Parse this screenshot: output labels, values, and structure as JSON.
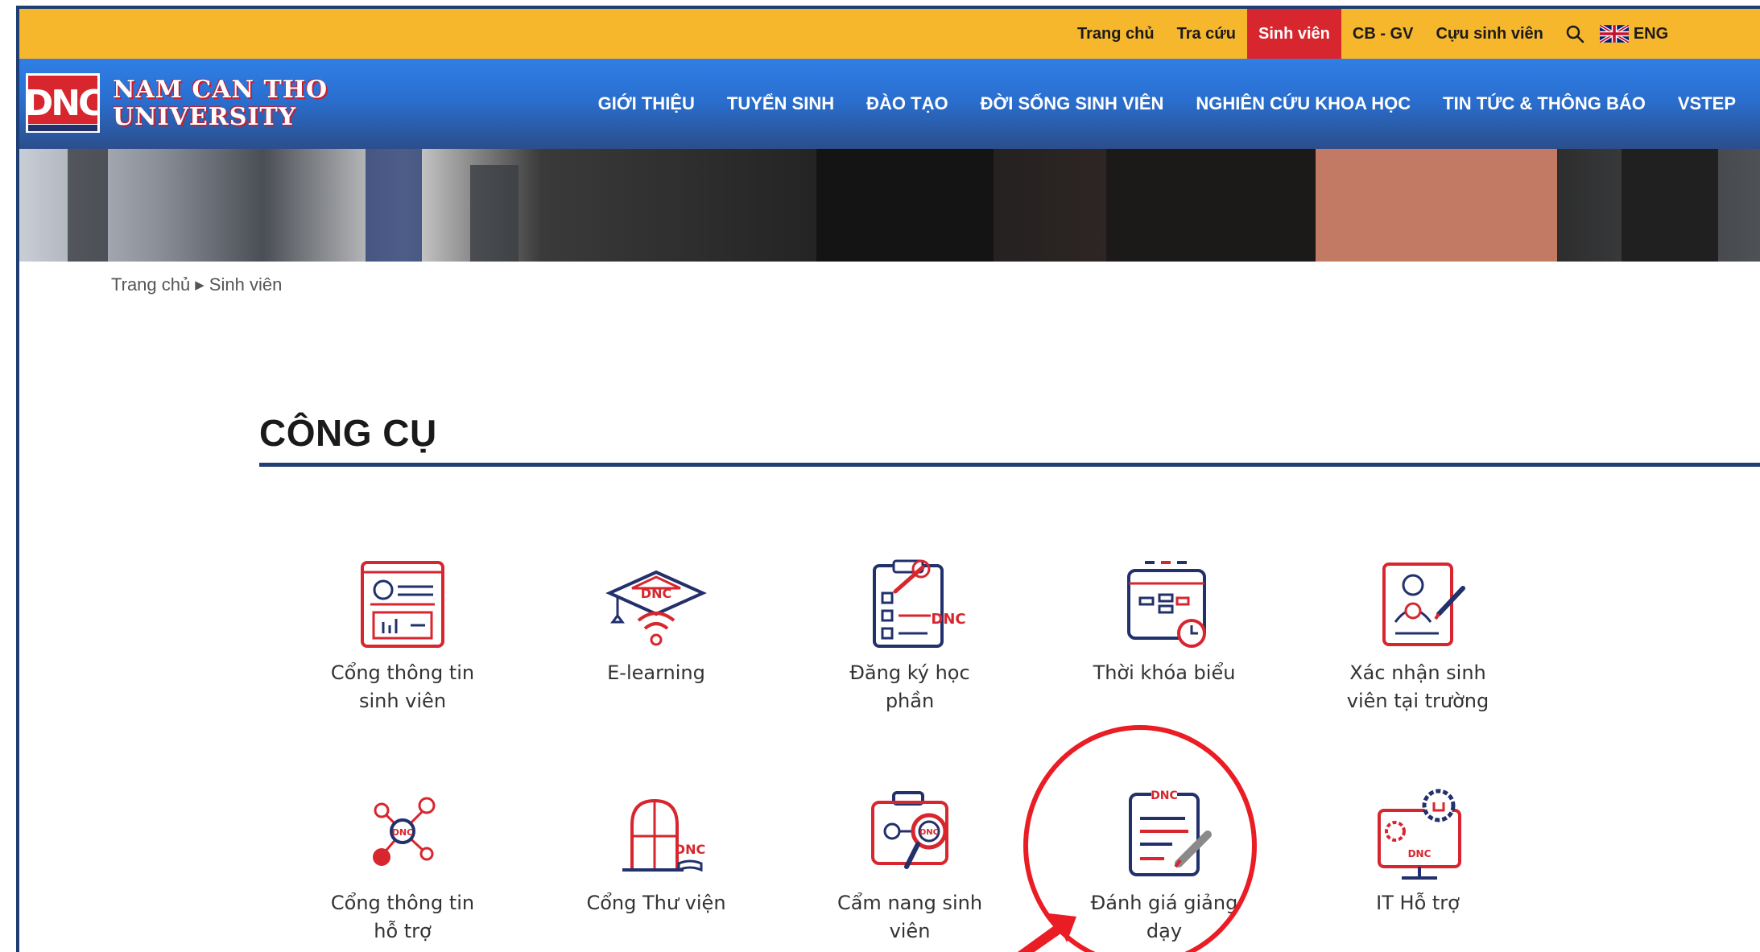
{
  "topbar": {
    "links": [
      {
        "label": "Trang chủ",
        "active": false
      },
      {
        "label": "Tra cứu",
        "active": false
      },
      {
        "label": "Sinh viên",
        "active": true
      },
      {
        "label": "CB - GV",
        "active": false
      },
      {
        "label": "Cựu sinh viên",
        "active": false
      }
    ],
    "language_label": "ENG",
    "search_icon": "search-icon",
    "flag_icon": "uk-flag-icon"
  },
  "header": {
    "logo_text_line1": "NAM CAN THO",
    "logo_text_line2": "UNIVERSITY",
    "menu": [
      {
        "label": "GIỚI THIỆU"
      },
      {
        "label": "TUYỂN SINH"
      },
      {
        "label": "ĐÀO TẠO"
      },
      {
        "label": "ĐỜI SỐNG SINH VIÊN"
      },
      {
        "label": "NGHIÊN CỨU KHOA HỌC"
      },
      {
        "label": "TIN TỨC & THÔNG BÁO"
      },
      {
        "label": "VSTEP"
      }
    ]
  },
  "breadcrumb": {
    "home": "Trang chủ",
    "current": "Sinh viên"
  },
  "section": {
    "title": "CÔNG CỤ"
  },
  "tools": [
    {
      "label_line1": "Cổng thông tin",
      "label_line2": "sinh viên",
      "icon": "student-portal-icon"
    },
    {
      "label_line1": "E-learning",
      "label_line2": "",
      "icon": "elearning-icon"
    },
    {
      "label_line1": "Đăng ký học",
      "label_line2": "phần",
      "icon": "course-registration-icon"
    },
    {
      "label_line1": "Thời khóa biểu",
      "label_line2": "",
      "icon": "timetable-icon"
    },
    {
      "label_line1": "Xác nhận sinh",
      "label_line2": "viên tại trường",
      "icon": "student-confirmation-icon"
    },
    {
      "label_line1": "Cổng thông tin",
      "label_line2": "hỗ trợ",
      "icon": "support-portal-icon"
    },
    {
      "label_line1": "Cổng Thư viện",
      "label_line2": "",
      "icon": "library-icon"
    },
    {
      "label_line1": "Cẩm nang sinh",
      "label_line2": "viên",
      "icon": "student-handbook-icon"
    },
    {
      "label_line1": "Đánh giá giảng",
      "label_line2": "dạy",
      "icon": "teaching-evaluation-icon"
    },
    {
      "label_line1": "IT Hỗ trợ",
      "label_line2": "",
      "icon": "it-support-icon"
    }
  ],
  "colors": {
    "topbar": "#f6b72d",
    "active_tab": "#d7262e",
    "nav_blue": "#2a6fd0",
    "navy": "#1f3f74",
    "icon_red": "#d7262e",
    "icon_navy": "#22306b",
    "highlight_red": "#ea1c24"
  }
}
